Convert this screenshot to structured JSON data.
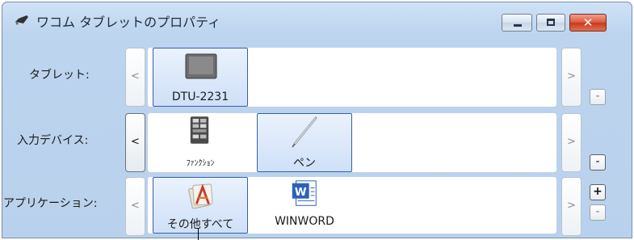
{
  "window": {
    "title": "ワコム タブレットのプロパティ",
    "icons": {
      "app": "pen-icon",
      "minimize": "minimize-icon",
      "maximize": "maximize-icon",
      "close": "close-icon"
    },
    "close_glyph": "✕"
  },
  "rows": {
    "tablet": {
      "label": "タブレット:",
      "nav_left": "<",
      "nav_right": ">",
      "remove": "-",
      "items": [
        {
          "label": "DTU-2231",
          "icon": "display-tablet-icon",
          "selected": true
        }
      ]
    },
    "input_device": {
      "label": "入力デバイス:",
      "nav_left": "<",
      "nav_right": ">",
      "remove": "-",
      "items": [
        {
          "label": "ﾌｧﾝｸｼｮﾝ",
          "icon": "function-keys-icon",
          "selected": false
        },
        {
          "label": "ペン",
          "icon": "pen-icon",
          "selected": true
        }
      ]
    },
    "application": {
      "label": "アプリケーション:",
      "nav_left": "<",
      "nav_right": ">",
      "add": "+",
      "remove": "-",
      "items": [
        {
          "label": "その他すべて",
          "icon": "all-other-apps-icon",
          "selected": true
        },
        {
          "label": "WINWORD",
          "icon": "word-icon",
          "selected": false
        }
      ]
    }
  },
  "colors": {
    "selection_border": "#3a5ea8",
    "selection_fill": "#d6e5f9",
    "window_bg": "#bcd4ee",
    "close_red": "#d9573c"
  }
}
